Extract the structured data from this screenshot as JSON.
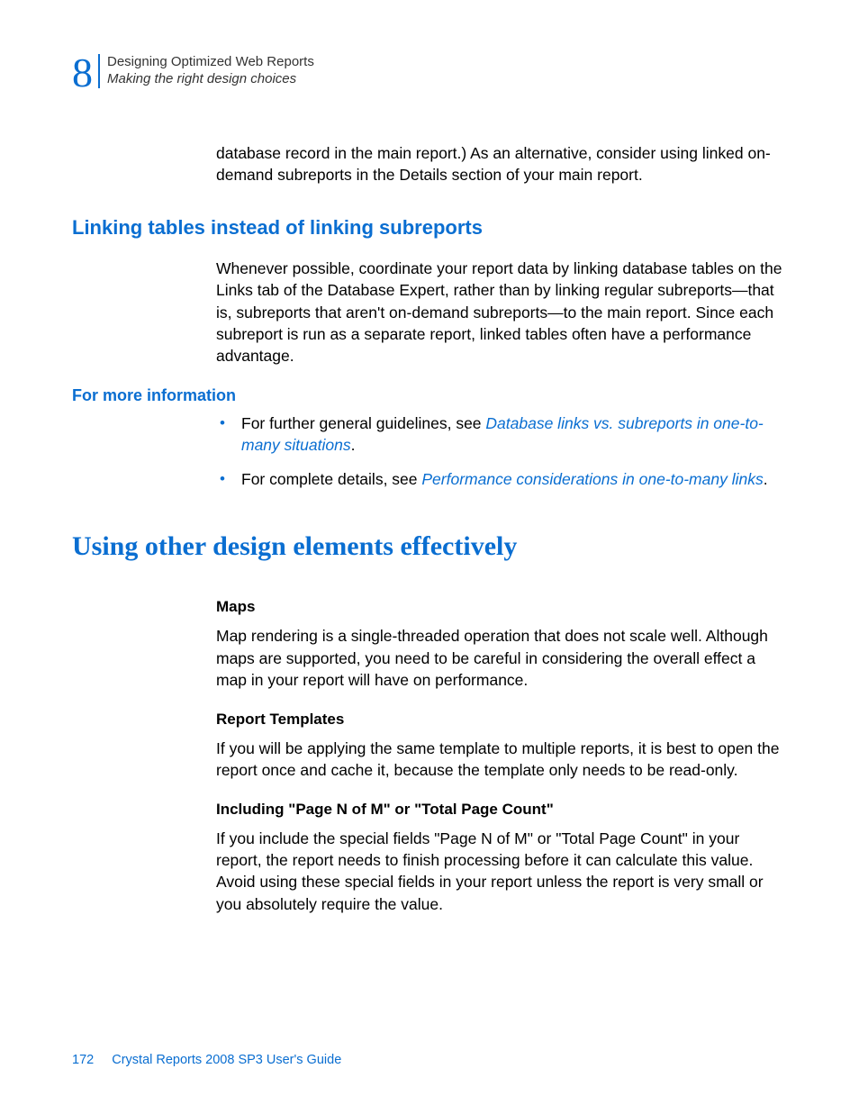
{
  "header": {
    "chapter_number": "8",
    "title": "Designing Optimized Web Reports",
    "subtitle": "Making the right design choices"
  },
  "intro_para": "database record in the main report.) As an alternative, consider using linked on-demand subreports in the Details section of your main report.",
  "section_linking": {
    "heading": "Linking tables instead of linking subreports",
    "body": "Whenever possible, coordinate your report data by linking database tables on the Links tab of the Database Expert, rather than by linking regular subreports—that is, subreports that aren't on-demand subreports—to the main report. Since each subreport is run as a separate report, linked tables often have a performance advantage."
  },
  "section_more_info": {
    "heading": "For more information",
    "bullets": [
      {
        "pre": "For further general guidelines, see ",
        "link": "Database links vs. subreports in one-to-many situations",
        "post": "."
      },
      {
        "pre": "For complete details, see ",
        "link": "Performance considerations in one-to-many links",
        "post": "."
      }
    ]
  },
  "section_other": {
    "heading": "Using other design elements effectively",
    "maps": {
      "title": "Maps",
      "body": "Map rendering is a single-threaded operation that does not scale well. Although maps are supported, you need to be careful in considering the overall effect a map in your report will have on performance."
    },
    "templates": {
      "title": "Report Templates",
      "body": "If you will be applying the same template to multiple reports, it is best to open the report once and cache it, because the template only needs to be read-only."
    },
    "pagecount": {
      "title": "Including \"Page N of M\" or \"Total Page Count\"",
      "body": "If you include the special fields \"Page N of M\" or \"Total Page Count\" in your report, the report needs to finish processing before it can calculate this value. Avoid using these special fields in your report unless the report is very small or you absolutely require the value."
    }
  },
  "footer": {
    "page_number": "172",
    "doc_title": "Crystal Reports 2008 SP3 User's Guide"
  }
}
